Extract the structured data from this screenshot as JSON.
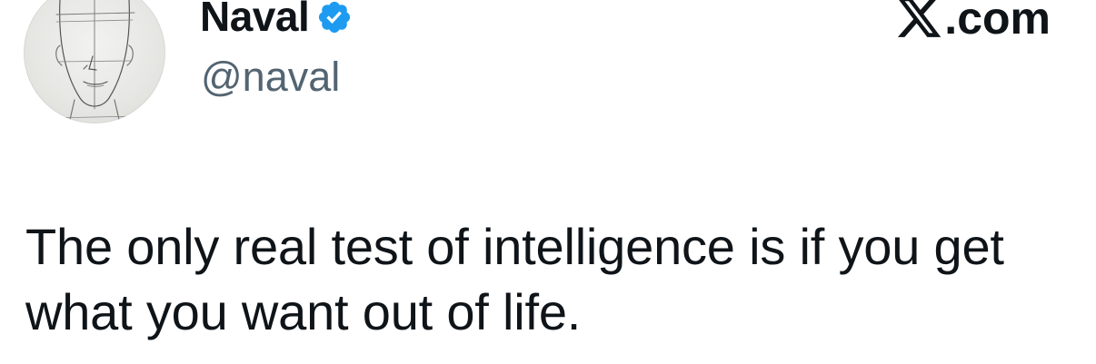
{
  "author": {
    "display_name": "Naval",
    "handle": "@naval",
    "verified": true,
    "avatar": "pencil-sketch-face-avatar",
    "verified_color": "#1d9bf0"
  },
  "brand": {
    "site": ".com",
    "logo": "x-logo"
  },
  "tweet": {
    "text": "The only real test of intelligence is if you get what you want out of life."
  },
  "colors": {
    "text": "#0f1419",
    "secondary_text": "#536471",
    "background": "#ffffff"
  }
}
